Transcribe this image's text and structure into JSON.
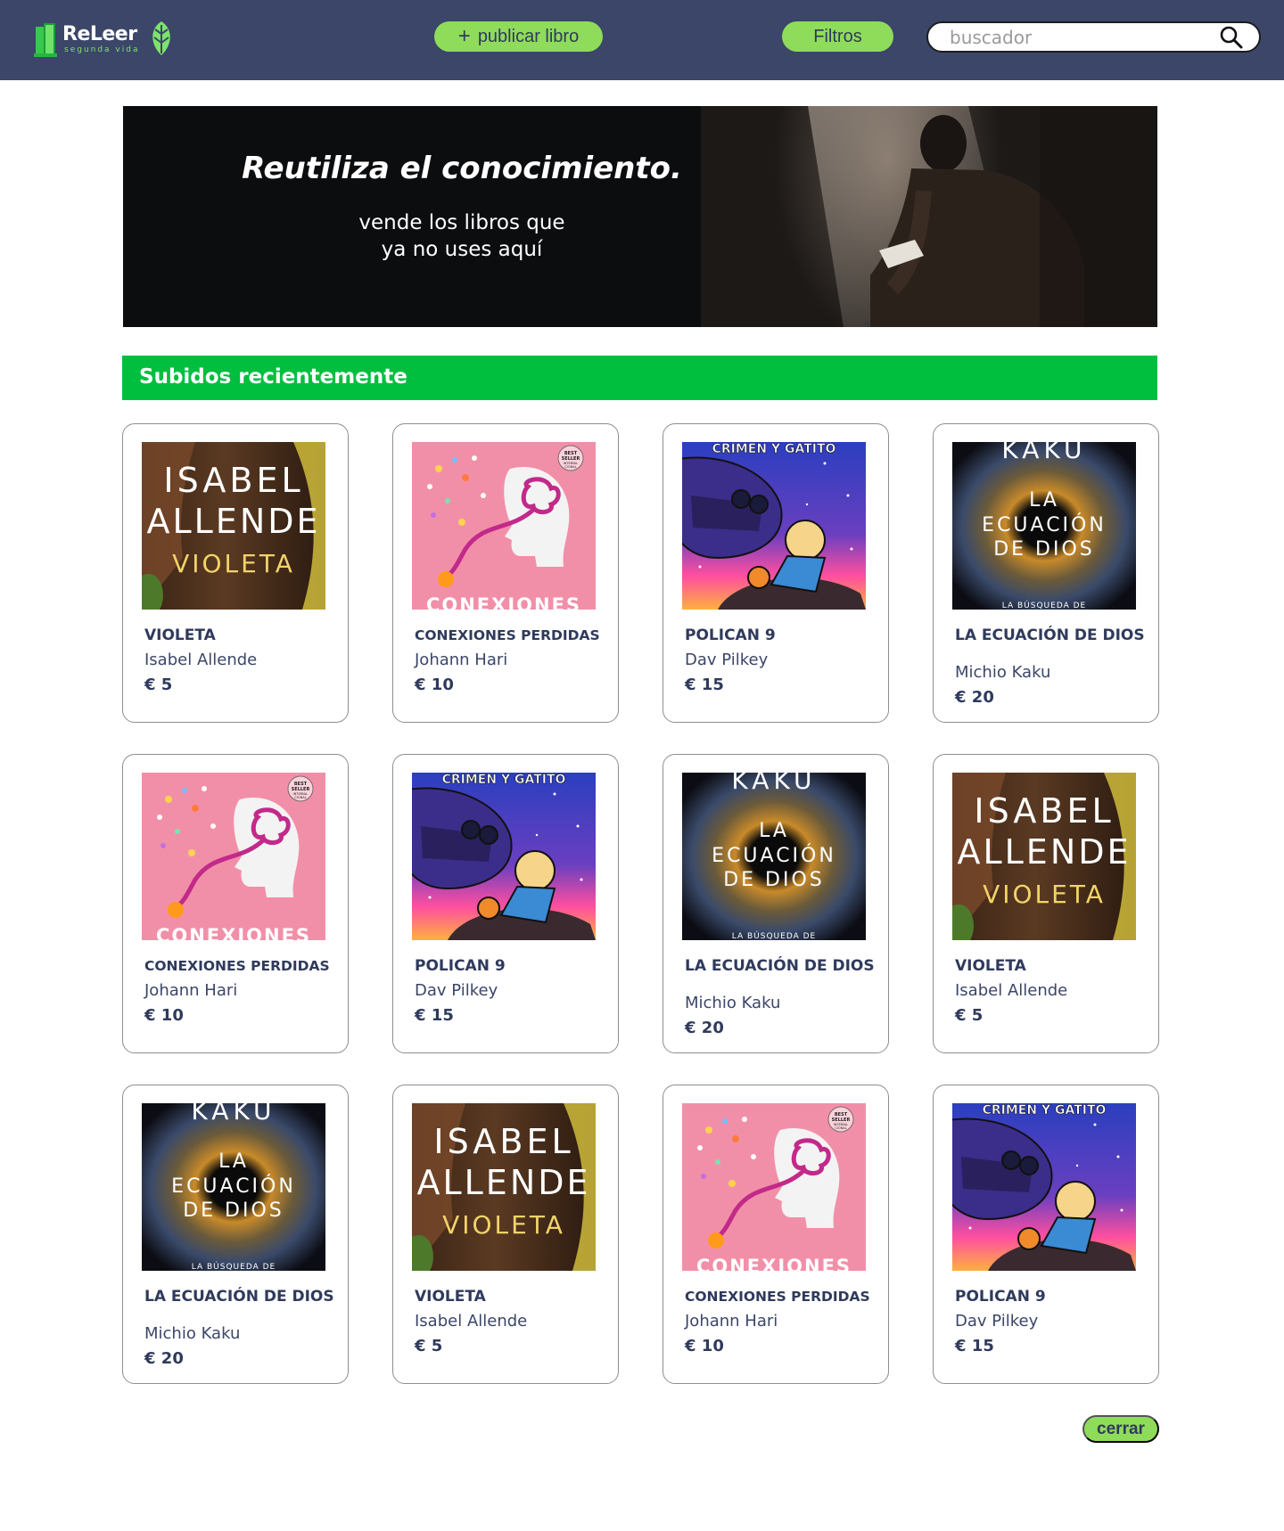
{
  "app": {
    "logo_title": "ReLeer",
    "logo_subtitle": "segunda vida"
  },
  "header": {
    "publish_label": "publicar libro",
    "publish_icon": "plus-icon",
    "filters_label": "Filtros",
    "search_placeholder": "buscador",
    "search_icon": "search-icon"
  },
  "hero": {
    "title": "Reutiliza el conocimiento.",
    "subtitle_line1": "vende los libros que",
    "subtitle_line2": "ya no uses aquí"
  },
  "section": {
    "title": "Subidos recientemente"
  },
  "books": [
    {
      "title": "VIOLETA",
      "author": "Isabel Allende",
      "price": "€ 5",
      "cover": "violeta"
    },
    {
      "title": "CONEXIONES PERDIDAS",
      "author": "Johann Hari",
      "price": "€ 10",
      "cover": "conexiones"
    },
    {
      "title": "POLICAN 9",
      "author": "Dav Pilkey",
      "price": "€ 15",
      "cover": "polican"
    },
    {
      "title": "LA ECUACIÓN DE DIOS",
      "author": "Michio Kaku",
      "price": "€ 20",
      "cover": "ecuacion"
    },
    {
      "title": "CONEXIONES PERDIDAS",
      "author": "Johann Hari",
      "price": "€ 10",
      "cover": "conexiones"
    },
    {
      "title": "POLICAN 9",
      "author": "Dav Pilkey",
      "price": "€ 15",
      "cover": "polican"
    },
    {
      "title": "LA ECUACIÓN DE DIOS",
      "author": "Michio Kaku",
      "price": "€ 20",
      "cover": "ecuacion"
    },
    {
      "title": "VIOLETA",
      "author": "Isabel Allende",
      "price": "€ 5",
      "cover": "violeta"
    },
    {
      "title": "LA ECUACIÓN DE DIOS",
      "author": "Michio Kaku",
      "price": "€ 20",
      "cover": "ecuacion"
    },
    {
      "title": "VIOLETA",
      "author": "Isabel Allende",
      "price": "€ 5",
      "cover": "violeta"
    },
    {
      "title": "CONEXIONES PERDIDAS",
      "author": "Johann Hari",
      "price": "€ 10",
      "cover": "conexiones"
    },
    {
      "title": "POLICAN 9",
      "author": "Dav Pilkey",
      "price": "€ 15",
      "cover": "polican"
    }
  ],
  "covers": {
    "violeta": {
      "line1": "ISABEL",
      "line2": "ALLENDE",
      "line3": "VIOLETA"
    },
    "conexiones": {
      "line1": "CONEXIONES",
      "badge1": "BEST",
      "badge2": "SELLER",
      "badge3": "INTERNA-",
      "badge4": "CIONAL"
    },
    "polican": {
      "line1": "CRIMEN Y GATITO"
    },
    "ecuacion": {
      "line1": "KAKU",
      "line2": "LA",
      "line3": "ECUACIÓN",
      "line4": "DE DIOS",
      "line5": "LA BÚSQUEDA DE"
    }
  },
  "footer": {
    "close_label": "cerrar"
  },
  "colors": {
    "header_bg": "#3b4669",
    "accent_green": "#8fdc5a",
    "section_green": "#00bf3f",
    "text_navy": "#2f3a5c"
  }
}
